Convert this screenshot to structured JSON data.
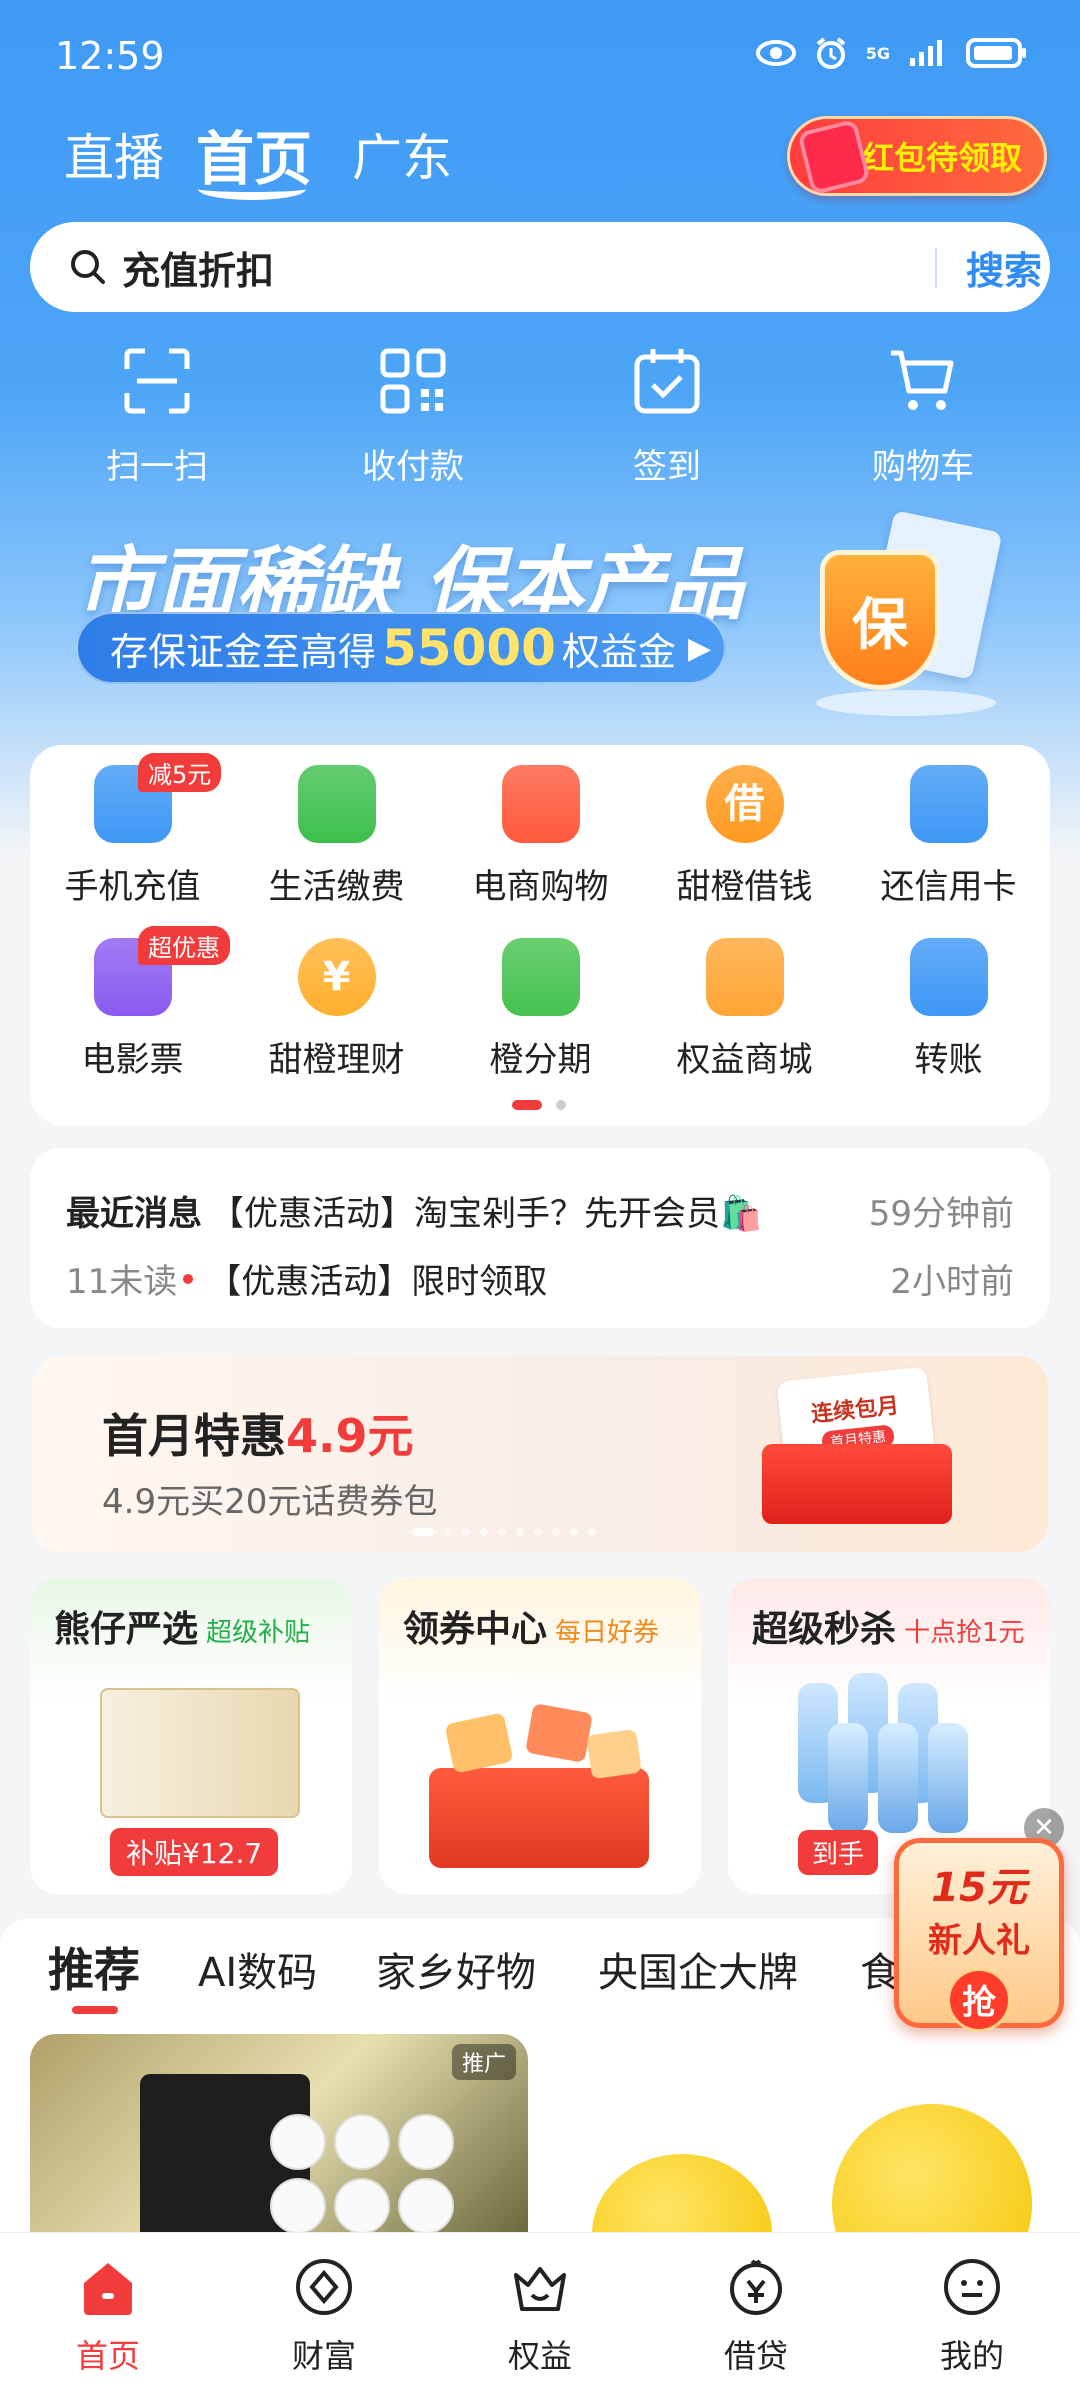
{
  "status_bar": {
    "time": "12:59",
    "network": "5G"
  },
  "header": {
    "tabs": [
      "直播",
      "首页",
      "广东"
    ],
    "active_tab": "首页",
    "red_packet": "红包待领取"
  },
  "search": {
    "placeholder": "充值折扣",
    "button": "搜索"
  },
  "quick_actions": [
    {
      "label": "扫一扫",
      "icon": "scan-icon"
    },
    {
      "label": "收付款",
      "icon": "qrcode-icon"
    },
    {
      "label": "签到",
      "icon": "calendar-check-icon"
    },
    {
      "label": "购物车",
      "icon": "cart-icon"
    }
  ],
  "banner": {
    "title": "市面稀缺 保本产品",
    "sub_before": "存保证金至高得",
    "sub_amount": "55000",
    "sub_after": "权益金",
    "badge": "保"
  },
  "services": [
    {
      "label": "手机充值",
      "icon": "phone-icon",
      "tag": "减5元",
      "color": "#3d97f5"
    },
    {
      "label": "生活缴费",
      "icon": "lightning-icon",
      "tag": "",
      "color": "#3dbf4d"
    },
    {
      "label": "电商购物",
      "icon": "shopping-bag-icon",
      "tag": "",
      "color": "#ff5a3d"
    },
    {
      "label": "甜橙借钱",
      "icon": "borrow-icon",
      "tag": "",
      "color": "#ff9a1f",
      "glyph": "借"
    },
    {
      "label": "还信用卡",
      "icon": "credit-card-icon",
      "tag": "",
      "color": "#3d97f5"
    },
    {
      "label": "电影票",
      "icon": "movie-icon",
      "tag": "超优惠",
      "color": "#8a5af0"
    },
    {
      "label": "甜橙理财",
      "icon": "coin-hand-icon",
      "tag": "",
      "color": "#ffb02e",
      "glyph": "¥"
    },
    {
      "label": "橙分期",
      "icon": "installment-icon",
      "tag": "",
      "color": "#45c24f"
    },
    {
      "label": "权益商城",
      "icon": "crown-icon",
      "tag": "",
      "color": "#ffa534"
    },
    {
      "label": "转账",
      "icon": "transfer-icon",
      "tag": "",
      "color": "#3d97f5"
    }
  ],
  "news": {
    "title": "最近消息",
    "line1": "【优惠活动】淘宝剁手？先开会员🛍️",
    "line1_time": "59分钟前",
    "unread": "11未读",
    "line2": "【优惠活动】限时领取",
    "line2_time": "2小时前"
  },
  "promo": {
    "title": "首月特惠",
    "price": "4.9元",
    "sub": "4.9元买20元话费券包",
    "badge_title": "连续包月",
    "badge_sub": "首月特惠"
  },
  "tiles": [
    {
      "title": "熊仔严选",
      "subtitle": "超级补贴",
      "sub_color": "#22b04a",
      "price_tag": "补贴¥12.7"
    },
    {
      "title": "领券中心",
      "subtitle": "每日好券",
      "sub_color": "#f08a1a",
      "price_tag": ""
    },
    {
      "title": "超级秒杀",
      "subtitle": "十点抢1元",
      "sub_color": "#f23c3c",
      "price_tag": "到手"
    }
  ],
  "float_ad": {
    "line1": "15元",
    "line2": "新人礼",
    "btn": "抢"
  },
  "category_tabs": [
    "推荐",
    "AI数码",
    "家乡好物",
    "央国企大牌",
    "食"
  ],
  "feed": {
    "ad_tag": "推广"
  },
  "bottom_nav": [
    {
      "label": "首页",
      "icon": "home-icon",
      "active": true
    },
    {
      "label": "财富",
      "icon": "wealth-icon",
      "active": false
    },
    {
      "label": "权益",
      "icon": "benefits-icon",
      "active": false
    },
    {
      "label": "借贷",
      "icon": "loan-icon",
      "active": false
    },
    {
      "label": "我的",
      "icon": "profile-icon",
      "active": false
    }
  ]
}
